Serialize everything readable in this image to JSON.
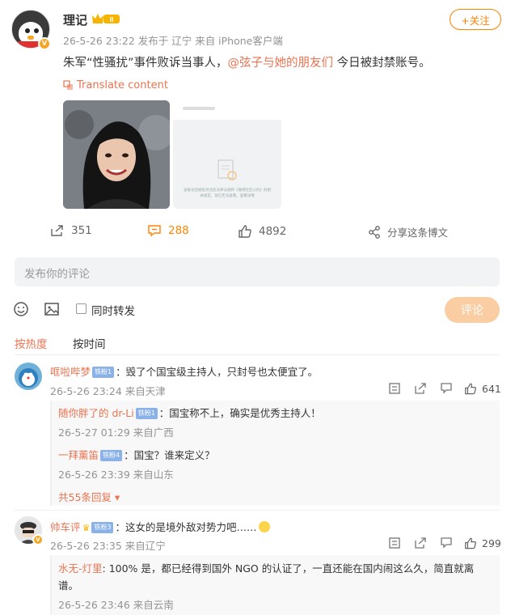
{
  "post": {
    "author": "理记",
    "level_badge": "Ⅲ",
    "meta": "26-5-26 23:22 发布于 辽宁 来自 iPhone客户端",
    "follow_label": "+关注",
    "text_before": "朱军“性骚扰”事件败诉当事人，",
    "mention": "@弦子与她的朋友们",
    "text_after": " 今日被封禁账号。",
    "translate_label": "Translate content",
    "image2_notice": "该账号因被投诉违反法律法规和《微博社区公约》的相关规定，现已无法查看。查看详情"
  },
  "actions": {
    "repost_count": "351",
    "comment_count": "288",
    "like_count": "4892",
    "share_label": "分享这条博文"
  },
  "composer": {
    "placeholder": "发布你的评论",
    "repost_label": "同时转发",
    "submit_label": "评论"
  },
  "sort_tabs": {
    "hot": "按热度",
    "time": "按时间"
  },
  "comments": [
    {
      "user": "哐啦哔梦",
      "badge": "铁粉1",
      "text": "：毁了个国宝级主持人，只封号也太便宜了。",
      "time": "26-5-26 23:24 来自天津",
      "likes": "641",
      "replies": [
        {
          "user": "随你胖了的 dr-Li",
          "badge": "铁粉1",
          "text": "：国宝称不上，确实是优秀主持人！",
          "time": "26-5-27 01:29 来自广西"
        },
        {
          "user": "一拜薰笛",
          "badge": "铁粉4",
          "text": "：国宝？谁来定义？",
          "time": "26-5-26 23:39 来自山东"
        }
      ],
      "more_label": "共55条回复"
    },
    {
      "user": "帅车评",
      "badge": "铁粉3",
      "text": "：这女的是境外敌对势力吧……",
      "time": "26-5-26 23:35 来自辽宁",
      "likes": "299",
      "replies": [
        {
          "user": "水无-灯里",
          "badge": "",
          "text": ": 100% 是，都已经得到国外 NGO 的认证了，一直还能在国内闹这么久，简直就离",
          "text2": "谱。",
          "time": "26-5-26 23:46 来自云南"
        }
      ]
    }
  ],
  "colors": {
    "accent": "#ff8200",
    "link": "#eb7350",
    "muted": "#939393"
  }
}
